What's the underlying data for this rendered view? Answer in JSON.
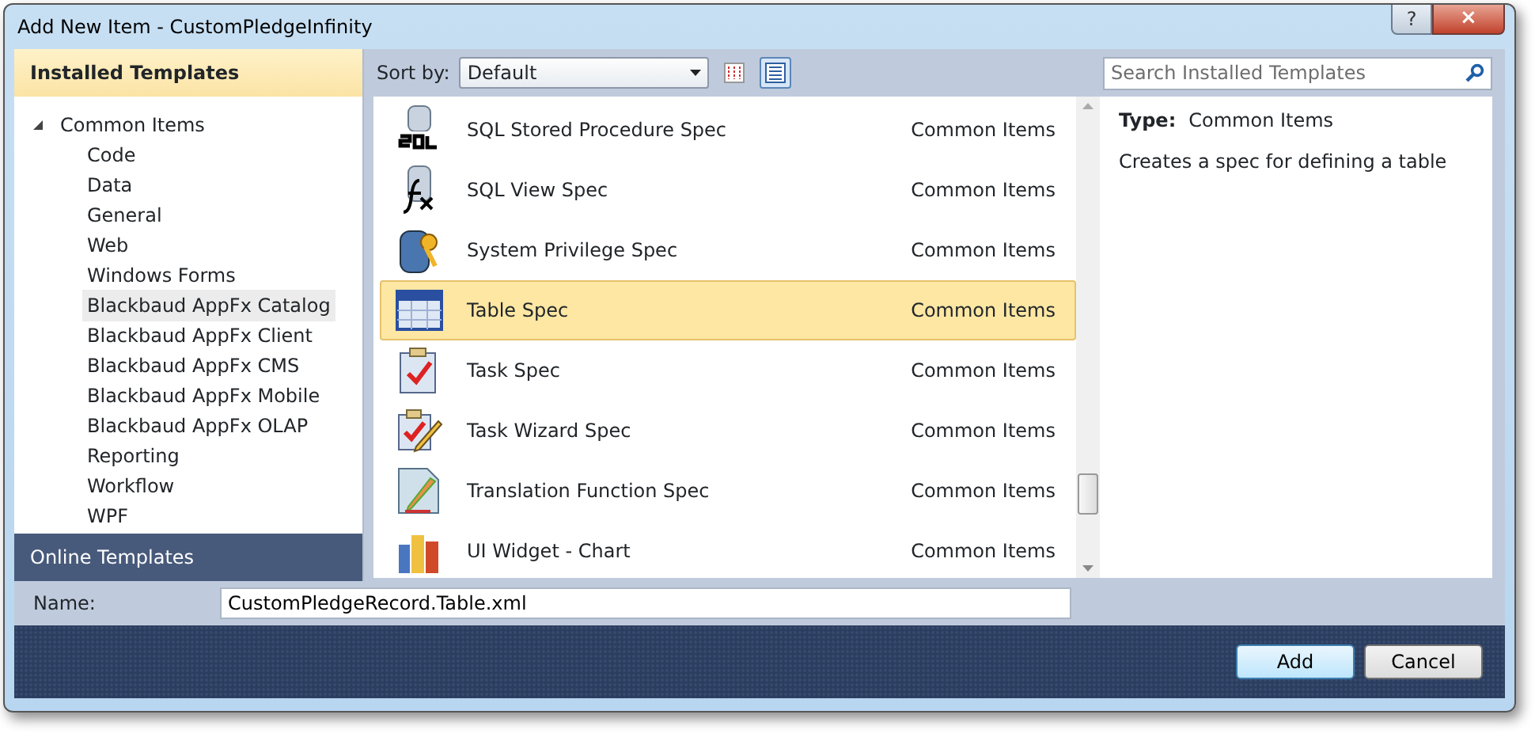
{
  "window": {
    "title": "Add New Item - CustomPledgeInfinity",
    "buttons": [
      "?",
      "×"
    ]
  },
  "installed_header": "Installed Templates",
  "tree": [
    {
      "label": "Common Items",
      "expanded": true,
      "selected": false,
      "children": [
        {
          "label": "Code",
          "selected": false
        },
        {
          "label": "Data",
          "selected": false
        },
        {
          "label": "General",
          "selected": false
        },
        {
          "label": "Web",
          "selected": false
        },
        {
          "label": "Windows Forms",
          "selected": false
        },
        {
          "label": "Blackbaud AppFx Catalog",
          "selected": true
        },
        {
          "label": "Blackbaud AppFx Client",
          "selected": false
        },
        {
          "label": "Blackbaud AppFx CMS",
          "selected": false
        },
        {
          "label": "Blackbaud AppFx Mobile",
          "selected": false
        },
        {
          "label": "Blackbaud AppFx OLAP",
          "selected": false
        },
        {
          "label": "Reporting",
          "selected": false
        },
        {
          "label": "Workflow",
          "selected": false
        },
        {
          "label": "WPF",
          "selected": false
        }
      ]
    }
  ],
  "online_header": "Online Templates",
  "sort": {
    "label": "Sort by:",
    "value": "Default"
  },
  "views": [
    {
      "kind": "small",
      "selected": false
    },
    {
      "kind": "list",
      "selected": true
    }
  ],
  "search": {
    "placeholder": "Search Installed Templates"
  },
  "templates": [
    {
      "kind": "sql",
      "name": "SQL Stored Procedure Spec",
      "category": "Common Items",
      "selected": false
    },
    {
      "kind": "view",
      "name": "SQL View Spec",
      "category": "Common Items",
      "selected": false
    },
    {
      "kind": "privilege",
      "name": "System Privilege Spec",
      "category": "Common Items",
      "selected": false
    },
    {
      "kind": "table",
      "name": "Table Spec",
      "category": "Common Items",
      "selected": true
    },
    {
      "kind": "task",
      "name": "Task Spec",
      "category": "Common Items",
      "selected": false
    },
    {
      "kind": "wizard",
      "name": "Task Wizard Spec",
      "category": "Common Items",
      "selected": false
    },
    {
      "kind": "translation",
      "name": "Translation Function Spec",
      "category": "Common Items",
      "selected": false
    },
    {
      "kind": "chart",
      "name": "UI Widget - Chart",
      "category": "Common Items",
      "selected": false
    }
  ],
  "details": {
    "type_label": "Type:",
    "type_value": "Common Items",
    "description": "Creates a spec for defining a table"
  },
  "name_field": {
    "label": "Name:",
    "value": "CustomPledgeRecord.Table.xml"
  },
  "buttons": [
    "Add",
    "Cancel"
  ]
}
